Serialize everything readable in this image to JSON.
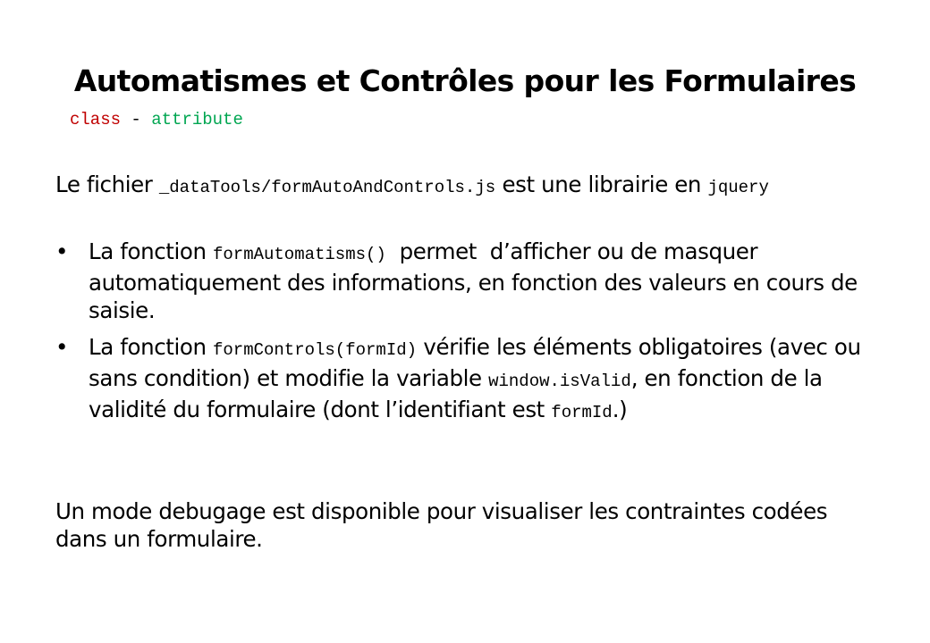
{
  "slide": {
    "title": "Automatismes et Contrôles pour les Formulaires",
    "subtitle": {
      "part1": "class",
      "separator": " - ",
      "part2": "attribute"
    },
    "intro": {
      "text1": "Le fichier ",
      "code1": "_dataTools/formAutoAndControls.js",
      "text2": " est une librairie en ",
      "code2": "jquery"
    },
    "bullets": [
      {
        "marker": "•",
        "text1": "La fonction ",
        "code1": "formAutomatisms()",
        "text2": "  permet  d’afficher ou de masquer automatiquement des informations, en fonction des valeurs en cours de saisie."
      },
      {
        "marker": "•",
        "text1": "La fonction ",
        "code1": "formControls(formId)",
        "text2": " vérifie les éléments obligatoires (avec ou sans condition) et modifie la variable ",
        "code2": "window.isValid",
        "text3": ", en fonction de la validité du formulaire (dont l’identifiant est ",
        "code3": "formId",
        "text4": ".)"
      }
    ],
    "outro": "Un mode debugage est disponible pour visualiser les contraintes codées dans un formulaire.",
    "colors": {
      "subtitle_part1": "#c00000",
      "subtitle_part2": "#00a651",
      "text": "#000000",
      "background": "#ffffff"
    }
  }
}
